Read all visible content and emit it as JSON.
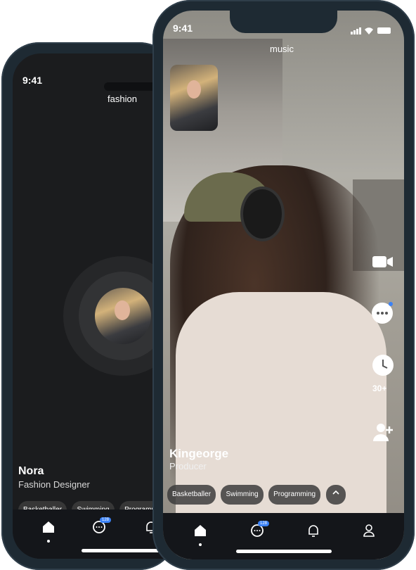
{
  "back_phone": {
    "time": "9:41",
    "category": "fashion",
    "profile": {
      "name": "Nora",
      "role": "Fashion Designer"
    },
    "tags": [
      "Basketballer",
      "Swimming",
      "Programming"
    ],
    "nav": {
      "messages_badge": "128"
    }
  },
  "front_phone": {
    "time": "9:41",
    "category": "music",
    "profile": {
      "name": "Kingeorge",
      "role": "Producer"
    },
    "tags": [
      "Basketballer",
      "Swimming",
      "Programming"
    ],
    "side_actions": {
      "timer_label": "30+"
    },
    "nav": {
      "messages_badge": "128"
    }
  },
  "colors": {
    "accent": "#3b82f6",
    "nav_bg": "#14161a",
    "screen_dark": "#1b1c1e"
  }
}
